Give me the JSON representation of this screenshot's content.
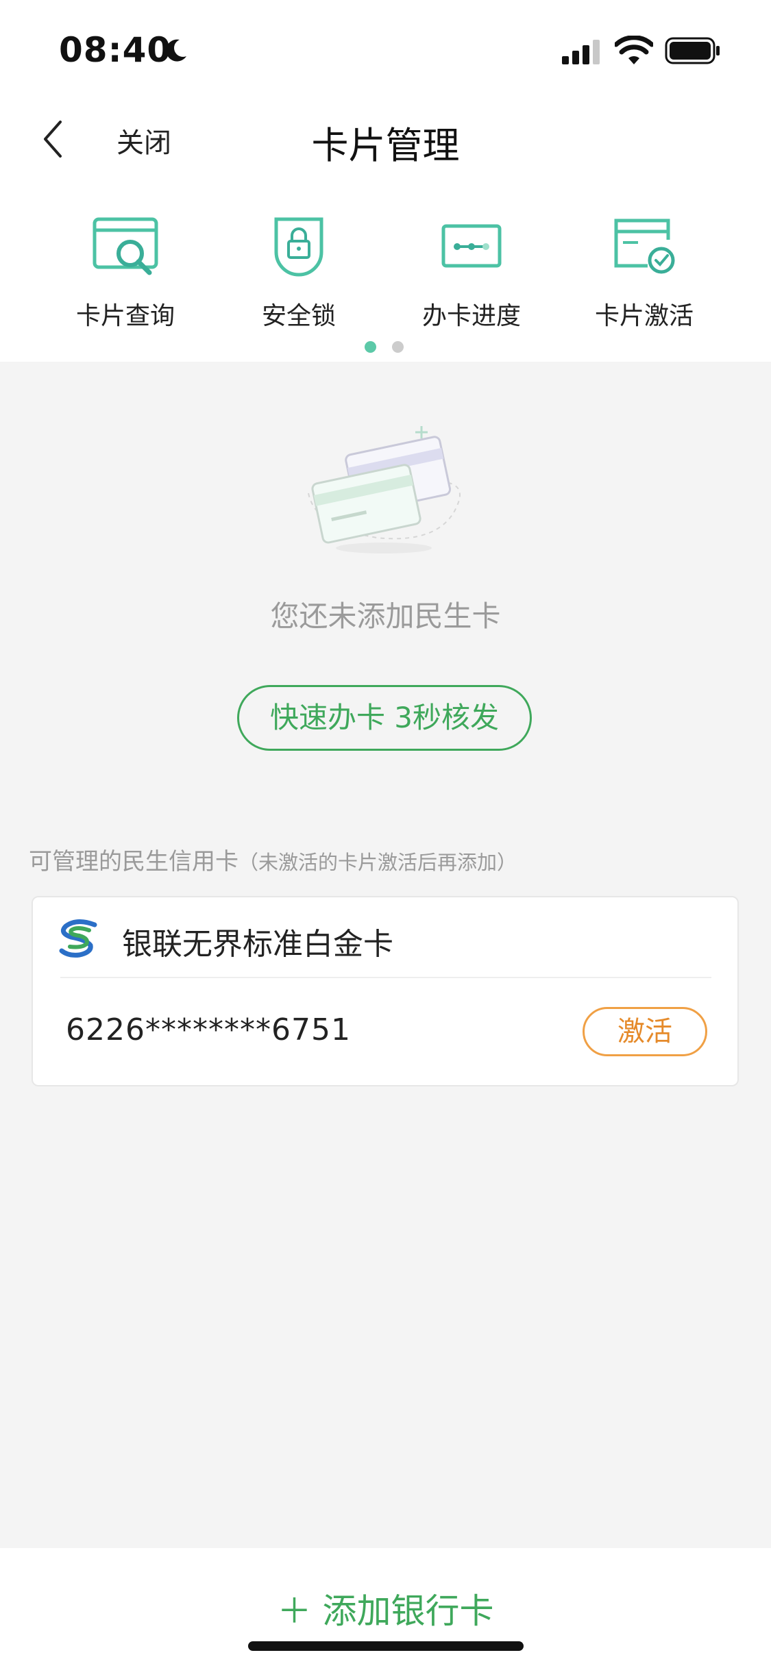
{
  "status_bar": {
    "time": "08:40"
  },
  "nav": {
    "close_label": "关闭",
    "title": "卡片管理"
  },
  "functions": [
    {
      "label": "卡片查询",
      "icon": "card-search-icon"
    },
    {
      "label": "安全锁",
      "icon": "lock-shield-icon"
    },
    {
      "label": "办卡进度",
      "icon": "progress-icon"
    },
    {
      "label": "卡片激活",
      "icon": "card-activate-icon"
    }
  ],
  "pager": {
    "current": 1,
    "total": 2
  },
  "empty_state": {
    "message": "您还未添加民生卡",
    "apply_label": "快速办卡 3秒核发"
  },
  "manageable": {
    "title": "可管理的民生信用卡",
    "note": "（未激活的卡片激活后再添加）",
    "cards": [
      {
        "name": "银联无界标准白金卡",
        "number": "6226********6751",
        "action": "激活"
      }
    ]
  },
  "bottom": {
    "add_label": "＋ 添加银行卡"
  },
  "colors": {
    "accent_green": "#3fa85b",
    "icon_teal": "#4cc2a4",
    "activate_orange": "#f0a045",
    "background": "#f4f4f4"
  }
}
